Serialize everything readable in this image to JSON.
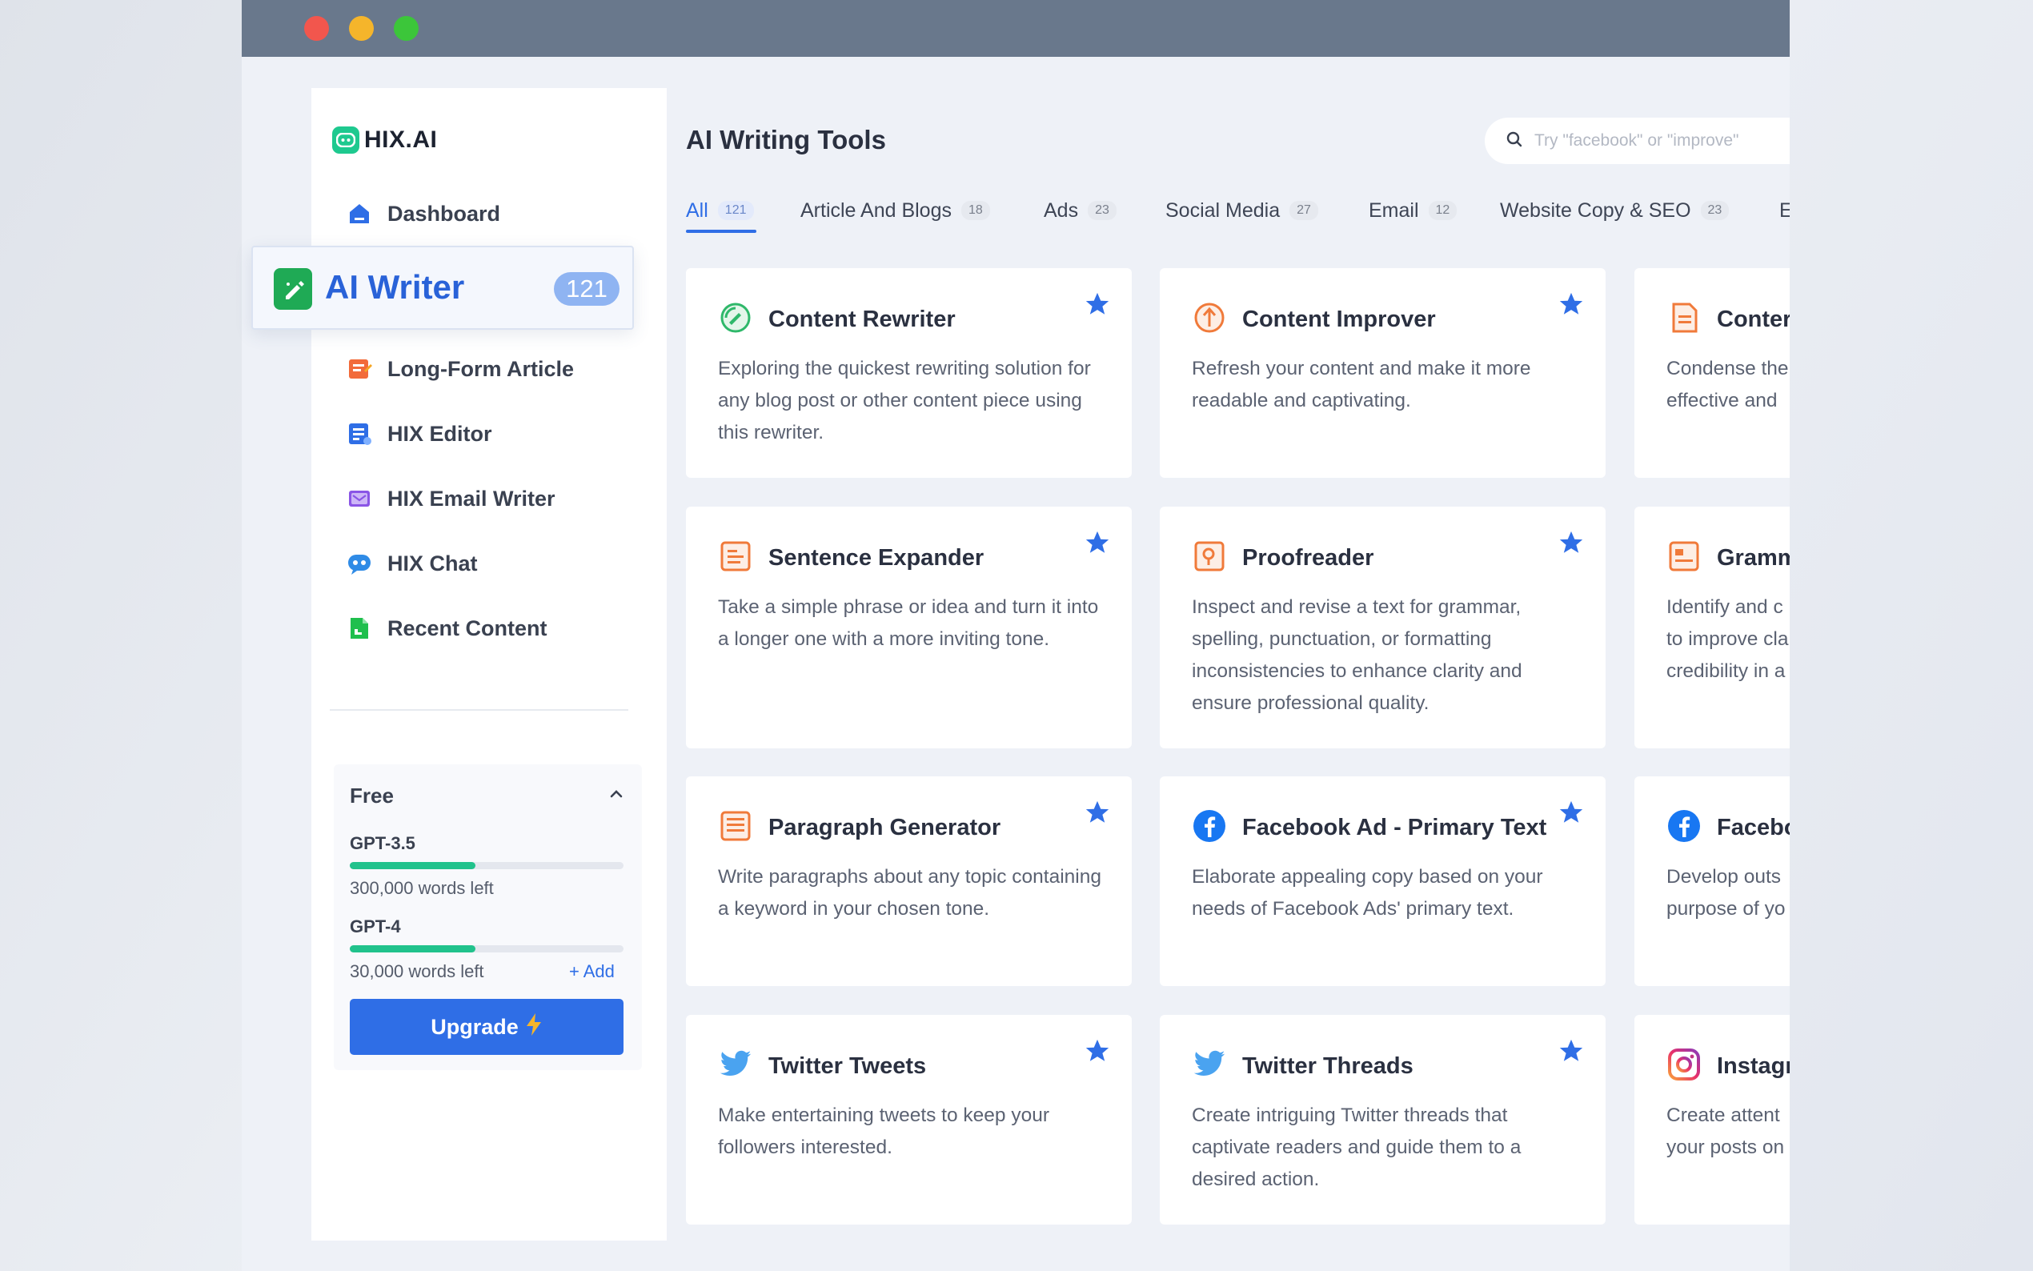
{
  "brand": {
    "name": "HIX.AI",
    "accent": "#2f6ee6",
    "logo_color": "#1ec98f"
  },
  "sidebar": {
    "items": [
      {
        "label": "Dashboard",
        "icon": "home-icon",
        "color": "#2f6ee6"
      },
      {
        "label": "Long-Form Article",
        "icon": "article-icon",
        "color": "#f26b3a"
      },
      {
        "label": "HIX Editor",
        "icon": "editor-icon",
        "color": "#2f6ee6"
      },
      {
        "label": "HIX Email Writer",
        "icon": "email-icon",
        "color": "#8a55e6"
      },
      {
        "label": "HIX Chat",
        "icon": "chat-icon",
        "color": "#2f8be6"
      },
      {
        "label": "Recent Content",
        "icon": "document-icon",
        "color": "#1fbf4d"
      }
    ],
    "active": {
      "label": "AI Writer",
      "count": "121",
      "icon": "pen-icon"
    },
    "plan": {
      "title": "Free",
      "models": [
        {
          "name": "GPT-3.5",
          "remaining": "300,000 words left",
          "fill": 0.46
        },
        {
          "name": "GPT-4",
          "remaining": "30,000 words left",
          "fill": 0.46
        }
      ],
      "add_label": "+ Add",
      "upgrade_label": "Upgrade"
    }
  },
  "main": {
    "title": "AI Writing Tools",
    "search_placeholder": "Try \"facebook\" or \"improve\"",
    "tabs": [
      {
        "label": "All",
        "count": "121",
        "active": true
      },
      {
        "label": "Article And Blogs",
        "count": "18"
      },
      {
        "label": "Ads",
        "count": "23"
      },
      {
        "label": "Social Media",
        "count": "27"
      },
      {
        "label": "Email",
        "count": "12"
      },
      {
        "label": "Website Copy & SEO",
        "count": "23"
      },
      {
        "label": "E",
        "count": ""
      }
    ],
    "cards": [
      {
        "title": "Content Rewriter",
        "desc": "Exploring the quickest rewriting solution for any blog post or other content piece using this rewriter.",
        "icon": "rewrite-icon"
      },
      {
        "title": "Content Improver",
        "desc": "Refresh your content and make it more readable and captivating.",
        "icon": "improve-icon"
      },
      {
        "title": "Conter",
        "desc": "Condense the effective and",
        "icon": "summary-icon"
      },
      {
        "title": "Sentence Expander",
        "desc": "Take a simple phrase or idea and turn it into a longer one with a more inviting tone.",
        "icon": "expand-icon"
      },
      {
        "title": "Proofreader",
        "desc": "Inspect and revise a text for grammar, spelling, punctuation, or formatting inconsistencies to enhance clarity and ensure professional quality.",
        "icon": "proofread-icon"
      },
      {
        "title": "Gramm",
        "desc": "Identify and c to improve cla credibility in a",
        "icon": "grammar-icon"
      },
      {
        "title": "Paragraph Generator",
        "desc": "Write paragraphs about any topic containing a keyword in your chosen tone.",
        "icon": "paragraph-icon"
      },
      {
        "title": "Facebook Ad - Primary Text",
        "desc": "Elaborate appealing copy based on your needs of Facebook Ads' primary text.",
        "icon": "facebook-icon"
      },
      {
        "title": "Facebo",
        "desc": "Develop outs purpose of yo",
        "icon": "facebook-icon"
      },
      {
        "title": "Twitter Tweets",
        "desc": "Make entertaining tweets to keep your followers interested.",
        "icon": "twitter-icon"
      },
      {
        "title": "Twitter Threads",
        "desc": "Create intriguing Twitter threads that captivate readers and guide them to a desired action.",
        "icon": "twitter-icon"
      },
      {
        "title": "Instagr",
        "desc": "Create attent your posts on",
        "icon": "instagram-icon"
      }
    ]
  }
}
